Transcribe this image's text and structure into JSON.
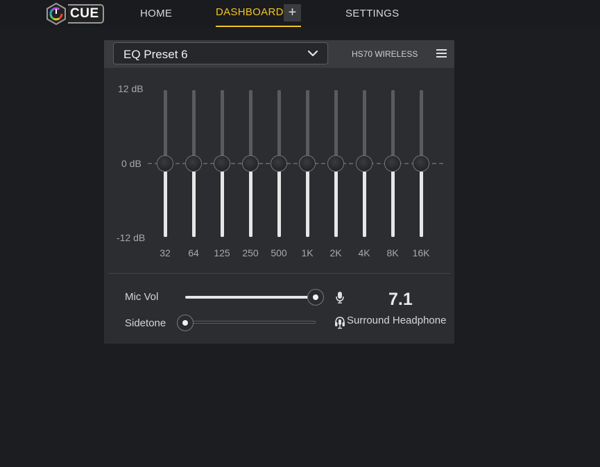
{
  "app": {
    "logo_text": "CUE"
  },
  "nav": {
    "home": "HOME",
    "dashboard": "DASHBOARD",
    "add": "+",
    "settings": "SETTINGS"
  },
  "panel": {
    "preset": "EQ Preset 6",
    "device": "HS70 WIRELESS",
    "eq": {
      "db_top": "12 dB",
      "db_mid": "0 dB",
      "db_bottom": "-12 dB",
      "bands": [
        {
          "freq": "32",
          "gain_db": 0
        },
        {
          "freq": "64",
          "gain_db": 0
        },
        {
          "freq": "125",
          "gain_db": 0
        },
        {
          "freq": "250",
          "gain_db": 0
        },
        {
          "freq": "500",
          "gain_db": 0
        },
        {
          "freq": "1K",
          "gain_db": 0
        },
        {
          "freq": "2K",
          "gain_db": 0
        },
        {
          "freq": "4K",
          "gain_db": 0
        },
        {
          "freq": "8K",
          "gain_db": 0
        },
        {
          "freq": "16K",
          "gain_db": 0
        }
      ]
    },
    "mic_vol": {
      "label": "Mic Vol",
      "level": 1.0
    },
    "sidetone": {
      "label": "Sidetone",
      "level": 0.0
    },
    "surround": {
      "value": "7.1",
      "label": "Surround Headphone"
    }
  },
  "colors": {
    "accent": "#f3c521",
    "background": "#1c1d20",
    "panel": "#2c2d31",
    "header": "#3a3b3f"
  },
  "icons": {
    "logo": "cue-hex-logo-icon",
    "chevron": "chevron-down-icon",
    "menu": "hamburger-menu-icon",
    "mic": "microphone-icon",
    "surround": "surround-headphone-icon"
  }
}
